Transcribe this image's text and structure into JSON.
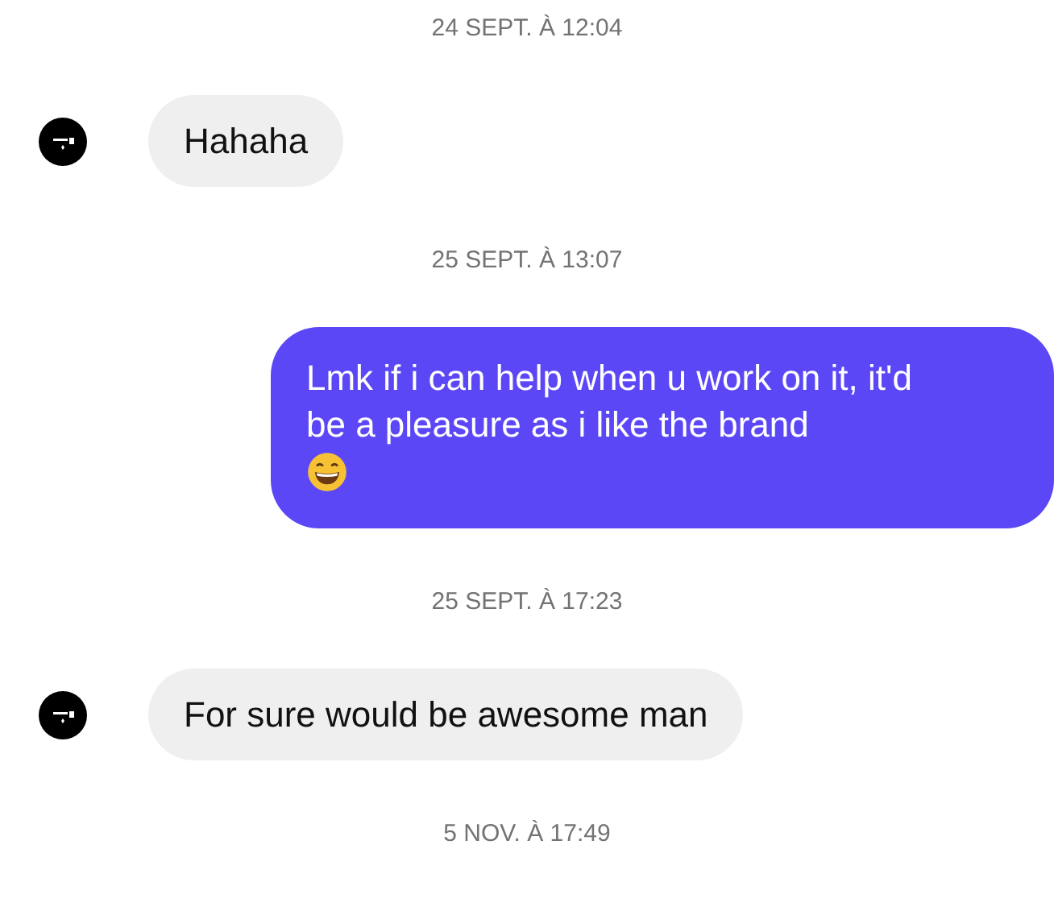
{
  "thread": [
    {
      "kind": "timestamp",
      "text": "24 SEPT. À 12:04"
    },
    {
      "kind": "received",
      "text": "Hahaha",
      "emoji": false
    },
    {
      "kind": "timestamp",
      "text": "25 SEPT. À 13:07"
    },
    {
      "kind": "sent",
      "text": "Lmk if i can help when u work on it, it'd be a pleasure as i like the brand",
      "emoji": true
    },
    {
      "kind": "timestamp",
      "text": "25 SEPT. À 17:23"
    },
    {
      "kind": "received",
      "text": "For sure would be awesome man",
      "emoji": false
    },
    {
      "kind": "timestamp",
      "text": "5 NOV. À 17:49"
    }
  ]
}
